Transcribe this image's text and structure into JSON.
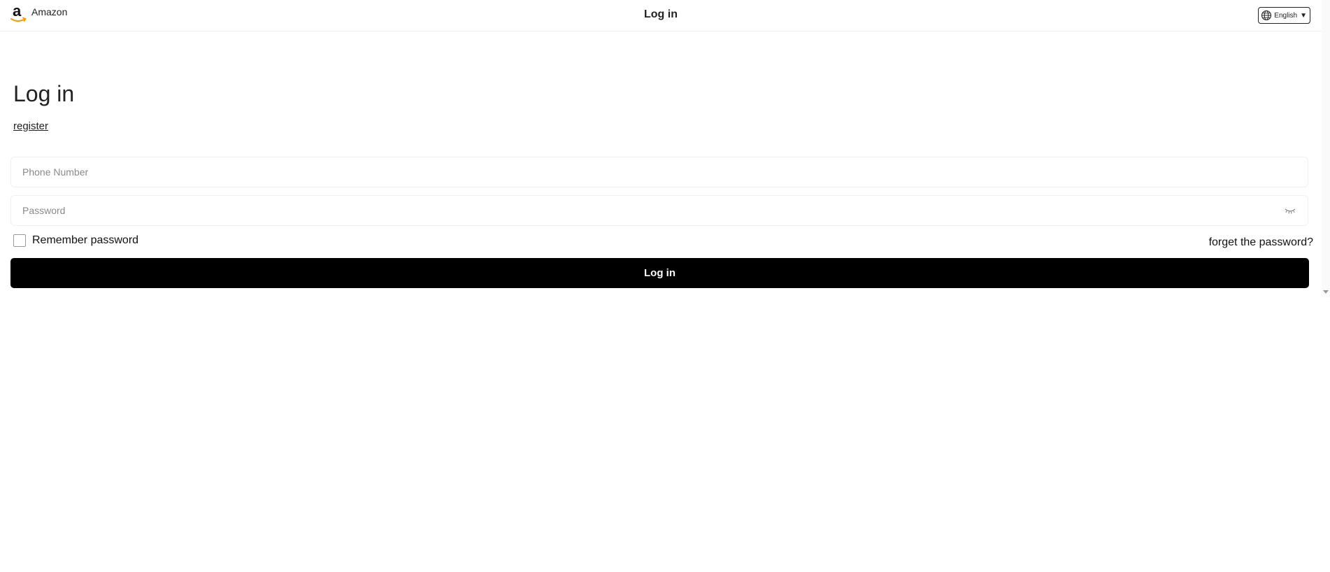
{
  "header": {
    "brand_name": "Amazon",
    "title": "Log in",
    "language": "English",
    "language_caret": "▼"
  },
  "main": {
    "title": "Log in",
    "register_link": "register",
    "phone_placeholder": "Phone Number",
    "password_placeholder": "Password",
    "remember_label": "Remember password",
    "remember_checked": false,
    "forgot_link": "forget the password?",
    "login_button": "Log in"
  },
  "icons": {
    "logo": "amazon-logo-icon",
    "language": "globe-icon",
    "password_toggle": "eye-closed-icon",
    "scroll": "scroll-down-arrow-icon"
  },
  "colors": {
    "brand_accent": "#ff9900",
    "button_bg": "#000000",
    "button_text": "#ffffff",
    "text": "#222222",
    "placeholder": "#8a8a8a"
  }
}
